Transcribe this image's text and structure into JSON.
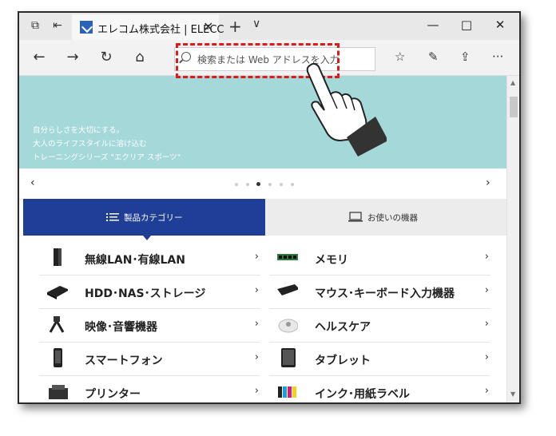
{
  "browser": {
    "tab_title": "エレコム株式会社 | ELECC",
    "tab_close": "✕",
    "new_tab": "+",
    "tab_menu": "∨",
    "address_placeholder": "検索または Web アドレスを入力",
    "window_controls": {
      "minimize": "—",
      "maximize": "□",
      "close": "✕"
    },
    "nav": {
      "back": "←",
      "forward": "→",
      "refresh": "↻",
      "home": "⌂"
    },
    "tools": {
      "reading_list": "☆",
      "pen": "✎",
      "share": "⇪",
      "more": "···"
    }
  },
  "hero": {
    "lines": [
      "自分らしさを大切にする。",
      "大人のライフスタイルに溶け込む",
      "トレーニングシリーズ \"エクリア スポーツ\""
    ],
    "prev": "‹",
    "next": "›"
  },
  "tabs": {
    "products": "製品カテゴリー",
    "devices": "お使いの機器"
  },
  "categories": [
    {
      "label": "無線LAN･有線LAN",
      "icon": "router-icon"
    },
    {
      "label": "メモリ",
      "icon": "memory-icon"
    },
    {
      "label": "HDD･NAS･ストレージ",
      "icon": "hdd-icon"
    },
    {
      "label": "マウス･キーボード入力機器",
      "icon": "mouse-keyboard-icon"
    },
    {
      "label": "映像･音響機器",
      "icon": "av-cable-icon"
    },
    {
      "label": "ヘルスケア",
      "icon": "scale-icon"
    },
    {
      "label": "スマートフォン",
      "icon": "smartphone-icon"
    },
    {
      "label": "タブレット",
      "icon": "tablet-icon"
    },
    {
      "label": "プリンター",
      "icon": "printer-icon"
    },
    {
      "label": "インク･用紙ラベル",
      "icon": "ink-icon"
    }
  ],
  "chevron": "›",
  "colors": {
    "hero_bg": "#a4d8d9",
    "tab_active": "#1f3f97",
    "highlight": "#e01919"
  }
}
